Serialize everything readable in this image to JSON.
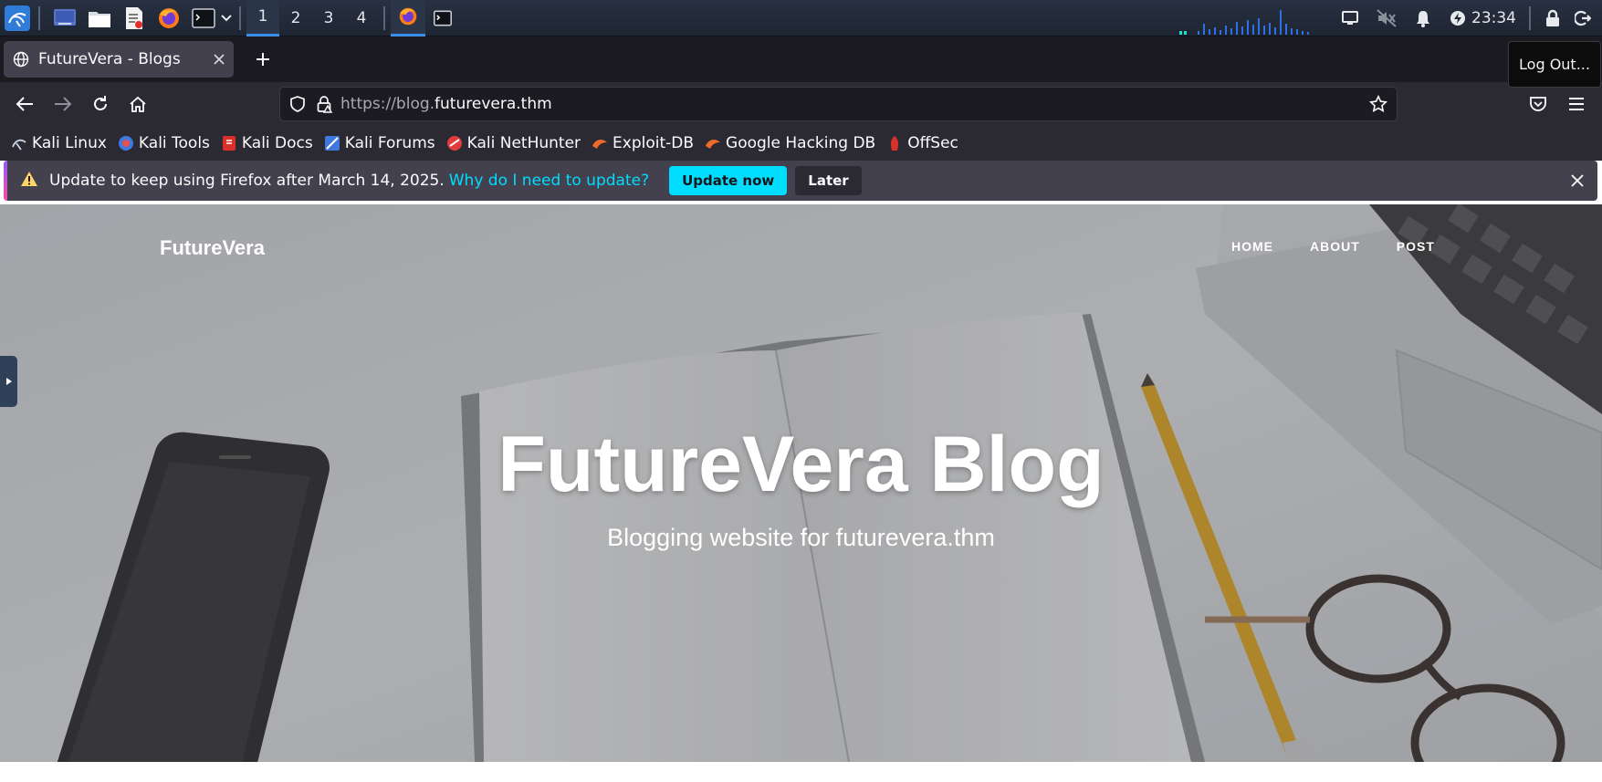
{
  "taskbar": {
    "workspaces": [
      "1",
      "2",
      "3",
      "4"
    ],
    "active_workspace": "1",
    "clock": "23:34",
    "icons": [
      "kali-menu-icon",
      "show-desktop-icon",
      "file-manager-icon",
      "text-editor-icon",
      "firefox-icon",
      "terminal-icon"
    ]
  },
  "browser": {
    "tab": {
      "title": "FutureVera - Blogs"
    },
    "tooltip": "Log Out...",
    "url": {
      "scheme": "https://blog.",
      "host": "futurevera.thm"
    },
    "bookmarks": [
      "Kali Linux",
      "Kali Tools",
      "Kali Docs",
      "Kali Forums",
      "Kali NetHunter",
      "Exploit-DB",
      "Google Hacking DB",
      "OffSec"
    ],
    "notification": {
      "message": "Update to keep using Firefox after March 14, 2025.",
      "link": "Why do I need to update?",
      "primary_button": "Update now",
      "secondary_button": "Later"
    }
  },
  "site": {
    "brand": "FutureVera",
    "nav": [
      "HOME",
      "ABOUT",
      "POST"
    ],
    "hero_title": "FutureVera Blog",
    "hero_subtitle": "Blogging website for futurevera.thm"
  },
  "colors": {
    "accent": "#00ddff",
    "taskbar_bg": "#1e2532",
    "browser_bg": "#2b2a33",
    "notification_bg": "#42414d"
  }
}
